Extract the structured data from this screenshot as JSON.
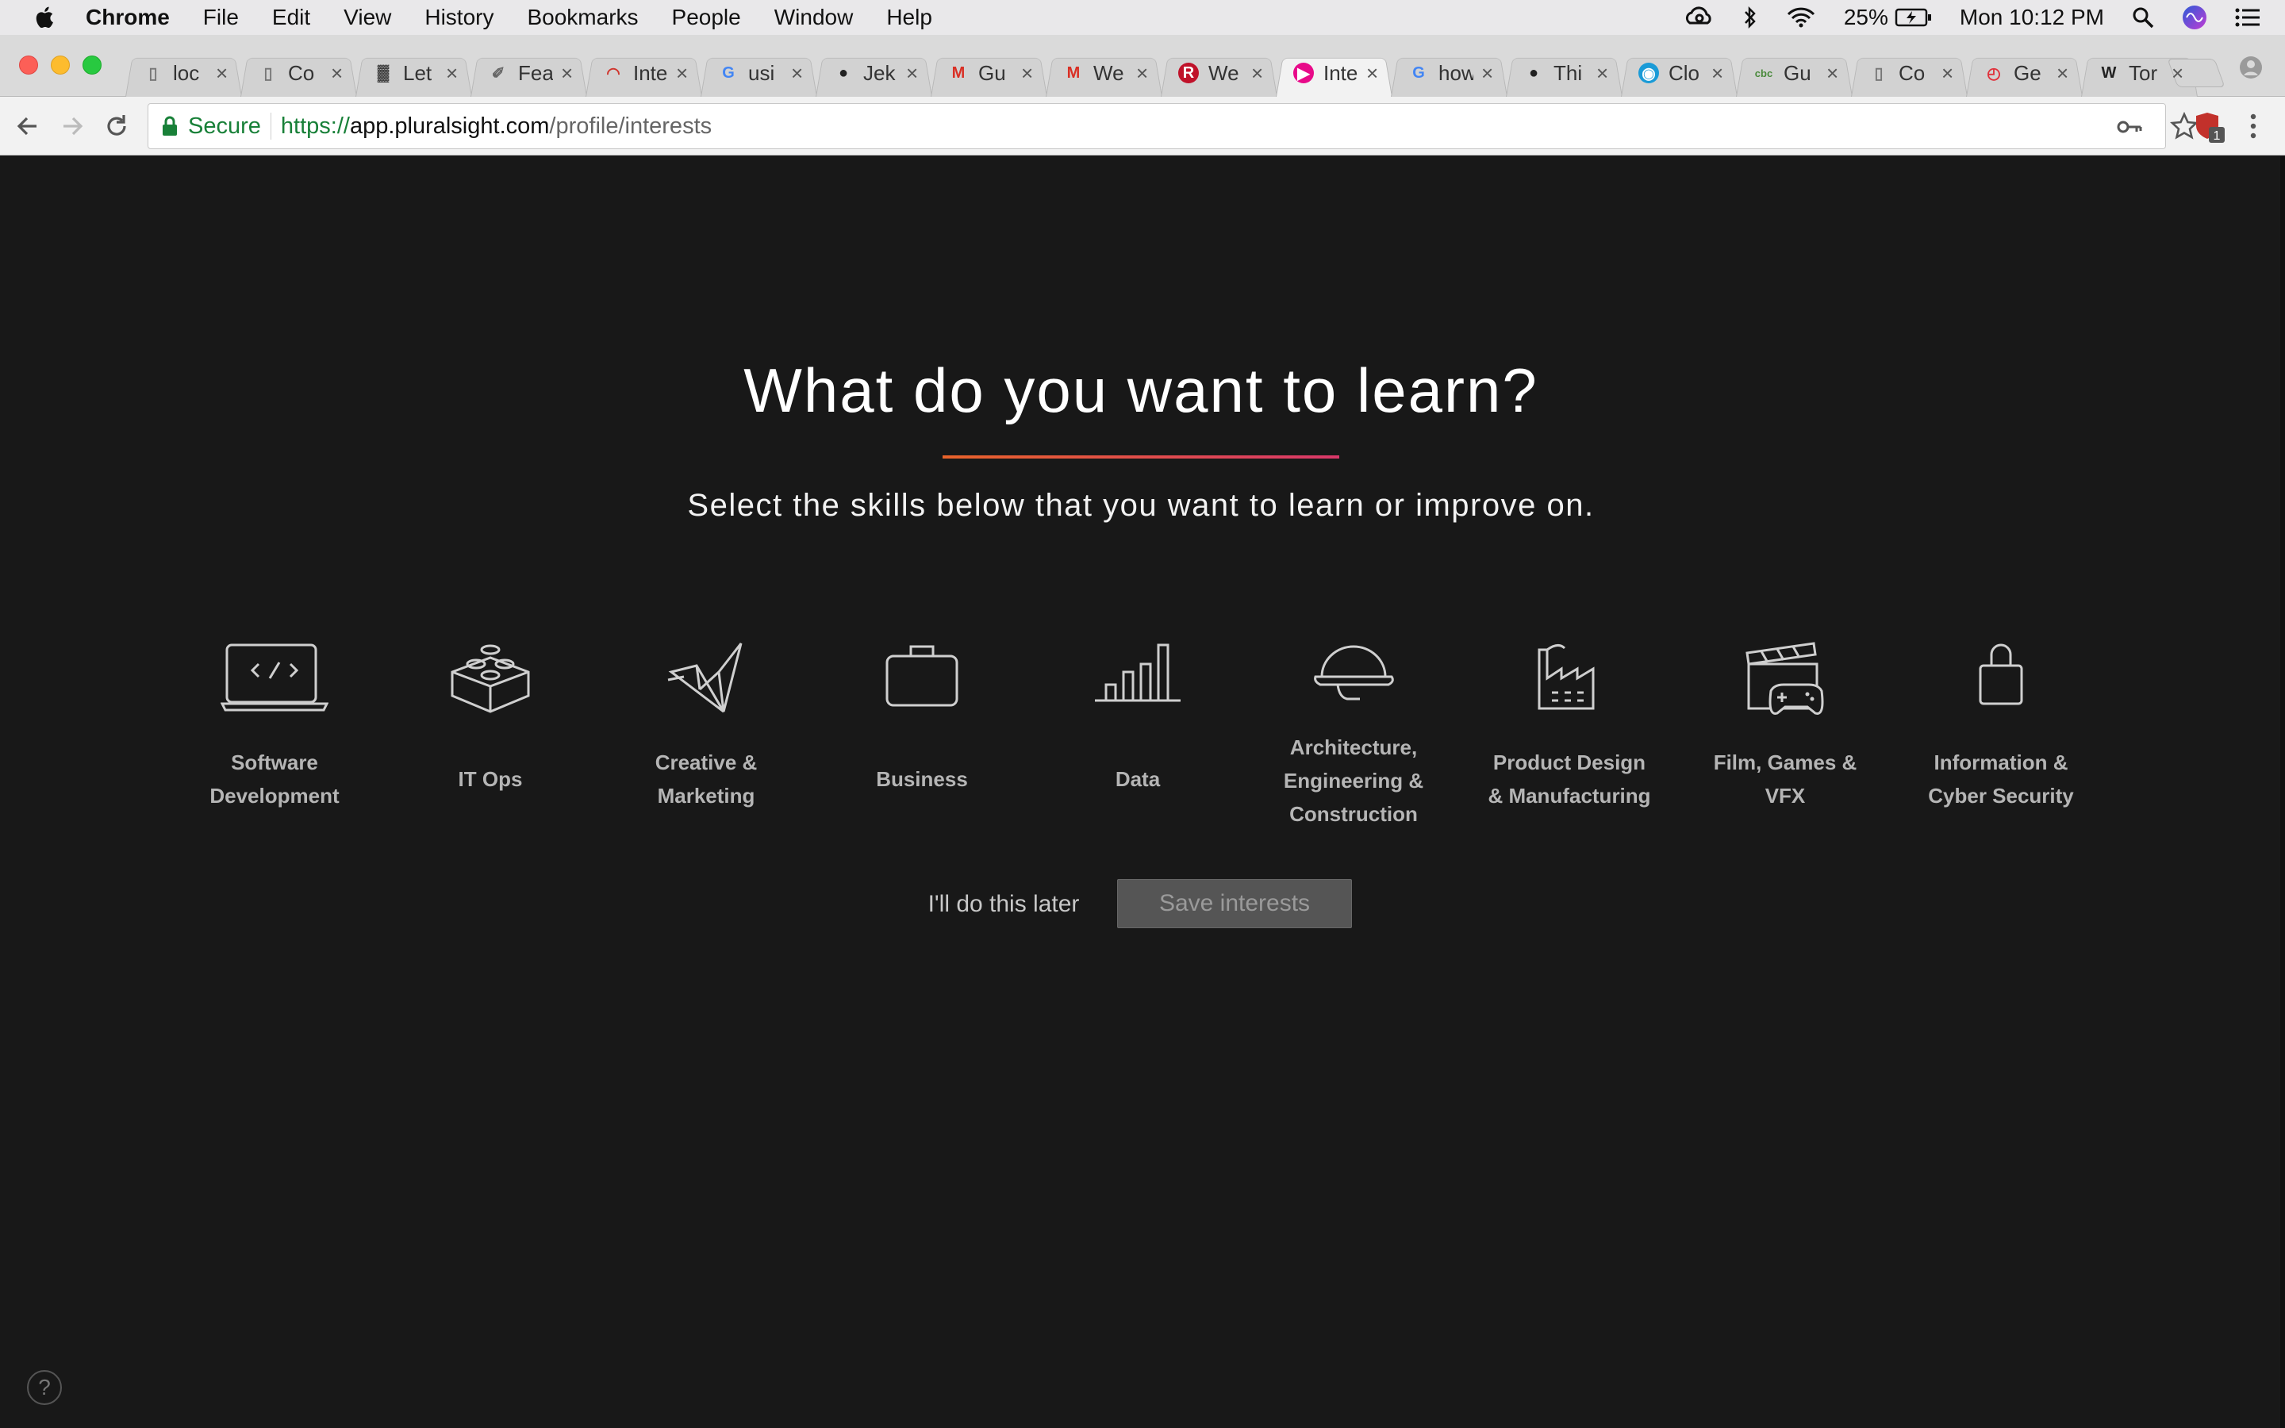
{
  "menubar": {
    "app_name": "Chrome",
    "menus": [
      "File",
      "Edit",
      "View",
      "History",
      "Bookmarks",
      "People",
      "Window",
      "Help"
    ],
    "battery": "25%",
    "clock": "Mon 10:12 PM"
  },
  "tabs": [
    {
      "title": "loc",
      "favicon": "doc-icon",
      "active": false
    },
    {
      "title": "Co",
      "favicon": "doc-icon",
      "active": false
    },
    {
      "title": "Let",
      "favicon": "chart-favicon",
      "active": false
    },
    {
      "title": "Fea",
      "favicon": "feather-icon",
      "active": false
    },
    {
      "title": "Inte",
      "favicon": "gauge-icon",
      "active": false
    },
    {
      "title": "usi",
      "favicon": "google-icon",
      "active": false
    },
    {
      "title": "Jek",
      "favicon": "github-icon",
      "active": false
    },
    {
      "title": "Gu",
      "favicon": "gmail-icon",
      "active": false
    },
    {
      "title": "We",
      "favicon": "gmail-icon",
      "active": false
    },
    {
      "title": "We",
      "favicon": "dr-icon",
      "active": false
    },
    {
      "title": "Inte",
      "favicon": "pluralsight-icon",
      "active": true
    },
    {
      "title": "how",
      "favicon": "google-icon",
      "active": false
    },
    {
      "title": "Thi",
      "favicon": "github-icon",
      "active": false
    },
    {
      "title": "Clo",
      "favicon": "eye-icon",
      "active": false
    },
    {
      "title": "Gu",
      "favicon": "cbc-icon",
      "active": false
    },
    {
      "title": "Co",
      "favicon": "doc-icon",
      "active": false
    },
    {
      "title": "Ge",
      "favicon": "clock-icon",
      "active": false
    },
    {
      "title": "Tor",
      "favicon": "wikipedia-icon",
      "active": false
    }
  ],
  "toolbar": {
    "secure_label": "Secure",
    "url_scheme": "https://",
    "url_host": "app.pluralsight.com",
    "url_path": "/profile/interests",
    "extension_badge": "1"
  },
  "page": {
    "heading": "What do you want to learn?",
    "subheading": "Select the skills below that you want to learn or improve on.",
    "interests": [
      {
        "icon": "laptop-code-icon",
        "lines": [
          "Software",
          "Development"
        ]
      },
      {
        "icon": "lego-brick-icon",
        "lines": [
          "IT Ops"
        ]
      },
      {
        "icon": "origami-bird-icon",
        "lines": [
          "Creative &",
          "Marketing"
        ]
      },
      {
        "icon": "briefcase-icon",
        "lines": [
          "Business"
        ]
      },
      {
        "icon": "bar-chart-icon",
        "lines": [
          "Data"
        ]
      },
      {
        "icon": "hard-hat-icon",
        "lines": [
          "Architecture,",
          "Engineering &",
          "Construction"
        ]
      },
      {
        "icon": "factory-icon",
        "lines": [
          "Product Design",
          "& Manufacturing"
        ]
      },
      {
        "icon": "clapper-gamepad-icon",
        "lines": [
          "Film, Games &",
          "VFX"
        ]
      },
      {
        "icon": "padlock-icon",
        "lines": [
          "Information &",
          "Cyber Security"
        ]
      }
    ],
    "later_label": "I'll do this later",
    "save_label": "Save interests",
    "help_label": "?"
  },
  "colors": {
    "page_bg": "#181818",
    "accent_gradient_start": "#e8632a",
    "accent_gradient_end": "#d9386a",
    "secure_green": "#188038"
  }
}
